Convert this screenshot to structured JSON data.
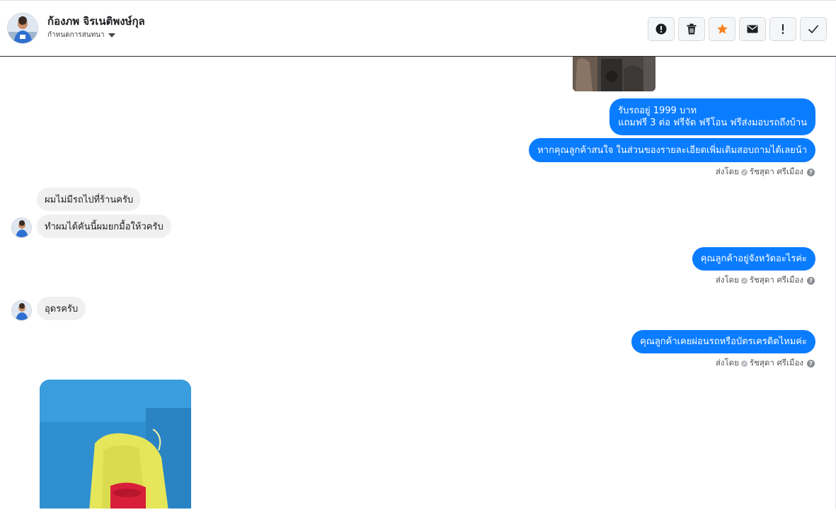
{
  "header": {
    "contact_name": "ก้องภพ จิรเนติพงษ์กุล",
    "conversation_action_label": "กำหนดการสนทนา",
    "actions": [
      {
        "name": "mark-spam-button",
        "icon": "exclamation-circle-icon"
      },
      {
        "name": "delete-button",
        "icon": "trash-icon"
      },
      {
        "name": "star-button",
        "icon": "star-icon",
        "color": "#f5821f"
      },
      {
        "name": "mark-unread-button",
        "icon": "envelope-icon"
      },
      {
        "name": "follow-up-button",
        "icon": "exclamation-icon"
      },
      {
        "name": "mark-done-button",
        "icon": "checkmark-icon"
      }
    ]
  },
  "messages": {
    "out_1_line_1": "รับรถอยู่ 1999 บาท",
    "out_1_line_2": "แถมฟรี 3 ต่อ ฟรีจัด ฟรีโอน  ฟรีส่งมอบรถถึงบ้าน",
    "out_2": "หากคุณลูกค้าสนใจ ในส่วนของรายละเอียดเพิ่มเติมสอบถามได้เลยน้า",
    "in_1": "ผมไม่มีรถไปที่ร้านครับ",
    "in_2": "ทำผมได้คันนี้ผมยกมื้อให้วครับ",
    "out_3": "คุณลูกค้าอยู่จังหวัดอะไรค่ะ",
    "in_3": "อุดรครับ",
    "out_4": "คุณลูกค้าเคยผ่อนรถหรือบัตรเครดิตไหมค่ะ"
  },
  "sent_by": {
    "prefix": "ส่งโดย",
    "agent_name": "รัชสุดา ศรีเมือง"
  },
  "colors": {
    "outgoing_bubble": "#0a7cff",
    "incoming_bubble": "#f0f0f0",
    "star_accent": "#f5821f"
  }
}
